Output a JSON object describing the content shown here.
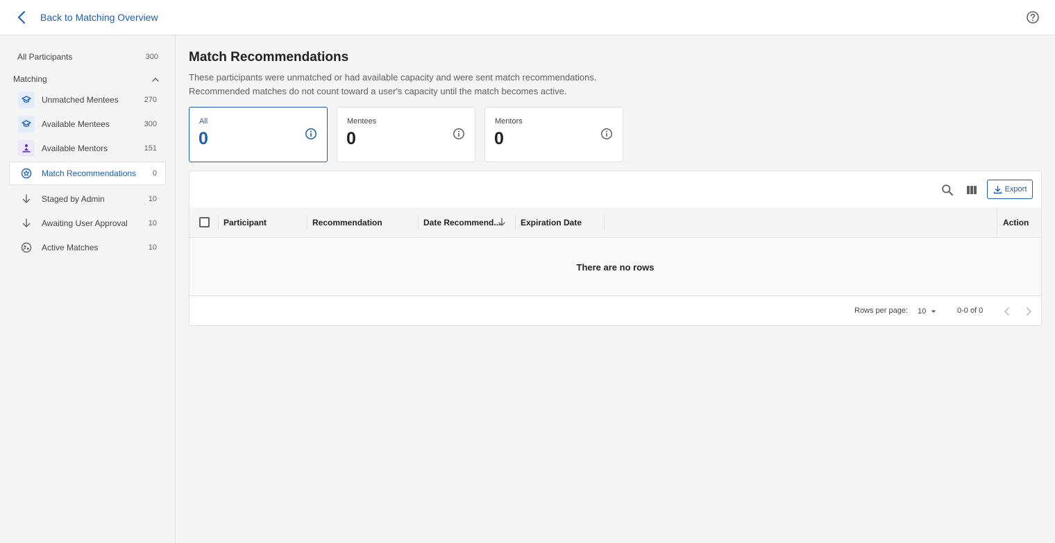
{
  "header": {
    "back_label": "Back to Matching Overview"
  },
  "sidebar": {
    "all_participants": {
      "label": "All Participants",
      "count": "300"
    },
    "section_label": "Matching",
    "items": [
      {
        "label": "Unmatched Mentees",
        "count": "270",
        "icon": "mortarboard-icon"
      },
      {
        "label": "Available Mentees",
        "count": "300",
        "icon": "mortarboard-icon"
      },
      {
        "label": "Available Mentors",
        "count": "151",
        "icon": "mentor-icon"
      },
      {
        "label": "Match Recommendations",
        "count": "0",
        "icon": "recommendation-icon"
      },
      {
        "label": "Staged by Admin",
        "count": "10",
        "icon": "arrow-down-icon"
      },
      {
        "label": "Awaiting User Approval",
        "count": "10",
        "icon": "arrow-down-icon"
      },
      {
        "label": "Active Matches",
        "count": "10",
        "icon": "active-match-icon"
      }
    ],
    "active_index": 3
  },
  "main": {
    "title": "Match Recommendations",
    "description_line1": "These participants were unmatched or had available capacity and were sent match recommendations.",
    "description_line2": "Recommended matches do not count toward a user's capacity until the match becomes active.",
    "stats": [
      {
        "label": "All",
        "value": "0"
      },
      {
        "label": "Mentees",
        "value": "0"
      },
      {
        "label": "Mentors",
        "value": "0"
      }
    ]
  },
  "table": {
    "export_label": "Export",
    "columns": [
      "Participant",
      "Recommendation",
      "Date Recommend...",
      "Expiration Date",
      "Action"
    ],
    "empty_text": "There are no rows",
    "rows_per_page_label": "Rows per page:",
    "rows_per_page_value": "10",
    "range_text": "0-0 of 0"
  },
  "colors": {
    "accent": "#1a5fb4",
    "background": "#f5f5f5",
    "border": "#e0e0e0"
  }
}
